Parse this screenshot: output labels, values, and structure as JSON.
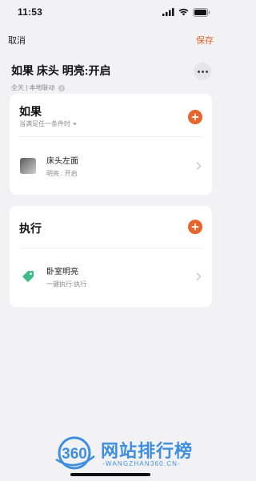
{
  "status_bar": {
    "time": "11:53"
  },
  "nav": {
    "cancel_label": "取消",
    "save_label": "保存"
  },
  "scene": {
    "title": "如果 床头 明亮:开启",
    "subtitle": "全天 | 本地联动"
  },
  "if_card": {
    "title": "如果",
    "hint": "当满足任一条件时",
    "items": [
      {
        "name": "床头左面",
        "detail": "明亮 : 开启"
      }
    ]
  },
  "do_card": {
    "title": "执行",
    "items": [
      {
        "name": "卧室明亮",
        "detail": "一键执行:执行"
      }
    ]
  },
  "watermark": {
    "badge": "360",
    "title": "网站排行榜",
    "subtitle": "-WANGZHAN360.CN-"
  },
  "colors": {
    "accent": "#e8642b",
    "tag_green": "#3dbb8a",
    "watermark_blue": "#3f8fe0"
  },
  "icons": {
    "status": [
      "signal-icon",
      "wifi-icon",
      "battery-icon"
    ],
    "more": "more-dots-icon",
    "add": "plus-circle-icon",
    "chevron": "chevron-right-icon",
    "tag": "tag-icon"
  }
}
